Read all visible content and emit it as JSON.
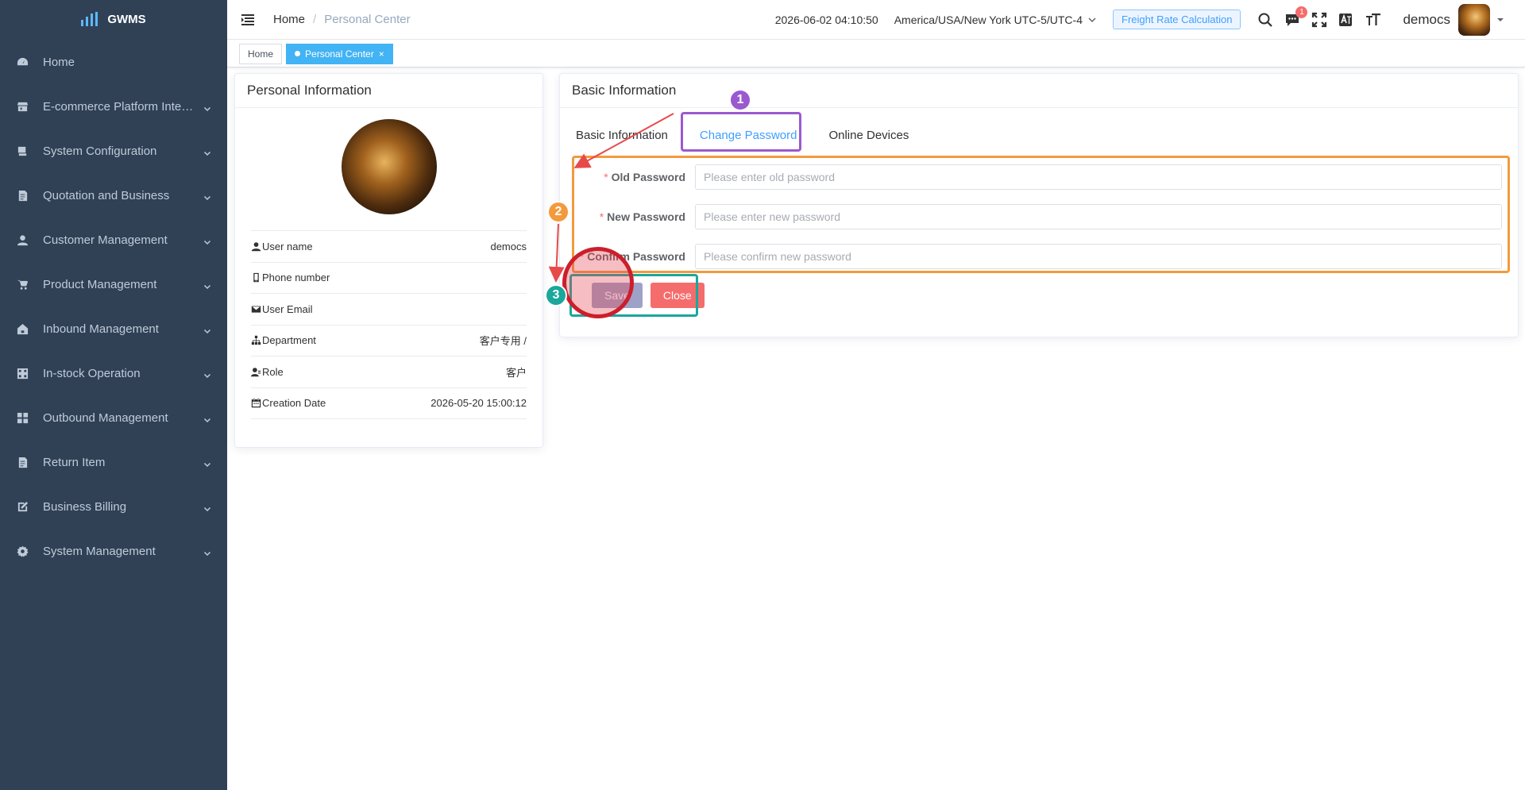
{
  "app": {
    "name": "GWMS"
  },
  "sidebar": {
    "items": [
      {
        "label": "Home",
        "icon": "dashboard-icon",
        "expandable": false
      },
      {
        "label": "E-commerce Platform Integr...",
        "icon": "store-icon",
        "expandable": true
      },
      {
        "label": "System Configuration",
        "icon": "config-icon",
        "expandable": true
      },
      {
        "label": "Quotation and Business",
        "icon": "document-icon",
        "expandable": true
      },
      {
        "label": "Customer Management",
        "icon": "user-icon",
        "expandable": true
      },
      {
        "label": "Product Management",
        "icon": "cart-icon",
        "expandable": true
      },
      {
        "label": "Inbound Management",
        "icon": "house-icon",
        "expandable": true
      },
      {
        "label": "In-stock Operation",
        "icon": "grid-icon",
        "expandable": true
      },
      {
        "label": "Outbound Management",
        "icon": "tiles-icon",
        "expandable": true
      },
      {
        "label": "Return Item",
        "icon": "document-icon",
        "expandable": true
      },
      {
        "label": "Business Billing",
        "icon": "edit-icon",
        "expandable": true
      },
      {
        "label": "System Management",
        "icon": "gear-icon",
        "expandable": true
      }
    ]
  },
  "header": {
    "breadcrumb": {
      "home": "Home",
      "separator": "/",
      "current": "Personal Center"
    },
    "datetime": "2026-06-02 04:10:50",
    "timezone": "America/USA/New York UTC-5/UTC-4",
    "freight_button": "Freight Rate Calculation",
    "message_badge": "1",
    "username": "democs"
  },
  "tags": [
    {
      "label": "Home",
      "active": false
    },
    {
      "label": "Personal Center",
      "active": true,
      "close": "×"
    }
  ],
  "personal_info": {
    "title": "Personal Information",
    "rows": [
      {
        "label": "User name",
        "value": "democs",
        "icon": "user-icon"
      },
      {
        "label": "Phone number",
        "value": "",
        "icon": "phone-icon"
      },
      {
        "label": "User Email",
        "value": "",
        "icon": "mail-icon"
      },
      {
        "label": "Department",
        "value": "客户专用 /",
        "icon": "tree-icon"
      },
      {
        "label": "Role",
        "value": "客户",
        "icon": "role-icon"
      },
      {
        "label": "Creation Date",
        "value": "2026-05-20 15:00:12",
        "icon": "calendar-icon"
      }
    ]
  },
  "basic_info": {
    "title": "Basic Information",
    "tabs": [
      {
        "label": "Basic Information",
        "active": false
      },
      {
        "label": "Change Password",
        "active": true
      },
      {
        "label": "Online Devices",
        "active": false
      }
    ],
    "form": {
      "old_password": {
        "label": "Old Password",
        "required": "*",
        "placeholder": "Please enter old password",
        "value": ""
      },
      "new_password": {
        "label": "New Password",
        "required": "*",
        "placeholder": "Please enter new password",
        "value": ""
      },
      "confirm_password": {
        "label": "Confirm Password",
        "required": "*",
        "placeholder": "Please confirm new password",
        "value": ""
      }
    },
    "buttons": {
      "save": "Save",
      "close": "Close"
    }
  },
  "annotations": {
    "step1": "1",
    "step2": "2",
    "step3": "3",
    "colors": {
      "step1": "#9b59d0",
      "step2": "#f39a3d",
      "step3": "#1aa79c",
      "highlight": "#cc1f2b"
    }
  }
}
